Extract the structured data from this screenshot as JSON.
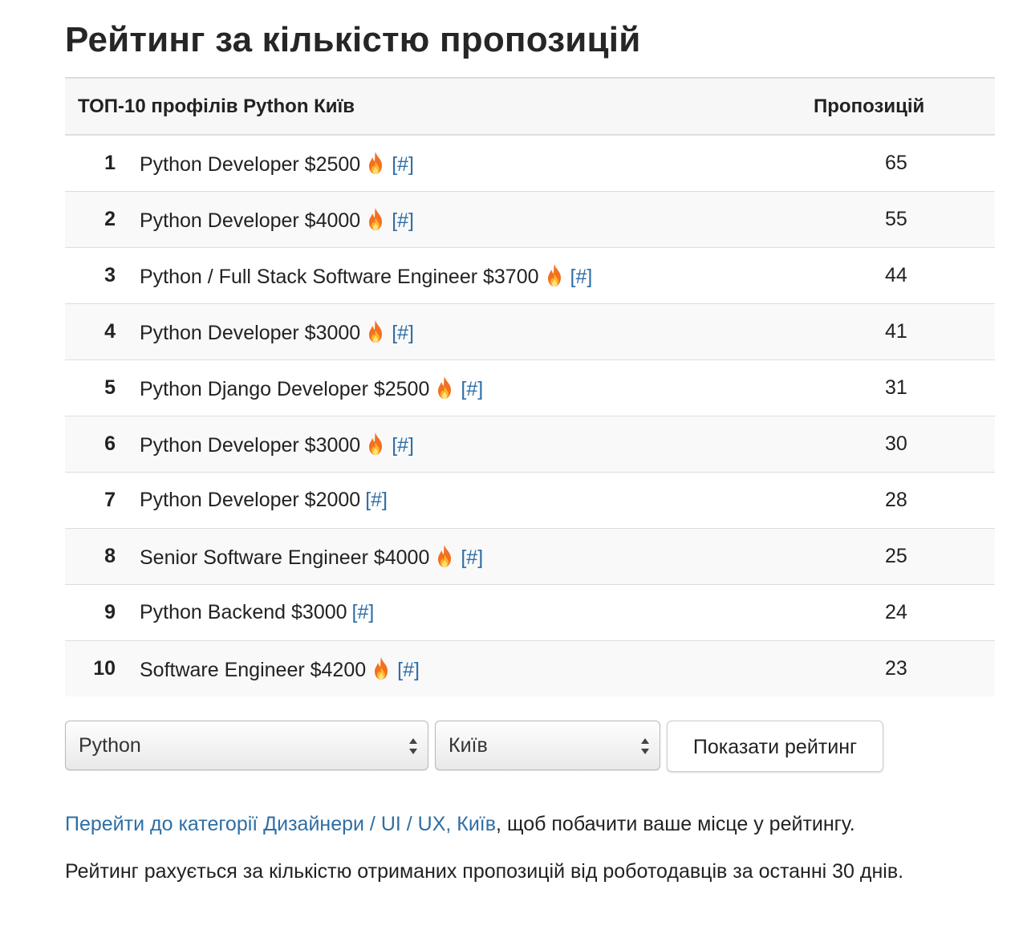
{
  "page": {
    "title": "Рейтинг за кількістю пропозицій"
  },
  "table": {
    "header_title": "ТОП-10 профілів Python Київ",
    "header_count": "Пропозицій",
    "anchor_label": "[#]",
    "rows": [
      {
        "rank": "1",
        "title": "Python Developer $2500",
        "hot": true,
        "count": "65"
      },
      {
        "rank": "2",
        "title": "Python Developer $4000",
        "hot": true,
        "count": "55"
      },
      {
        "rank": "3",
        "title": "Python / Full Stack Software Engineer $3700",
        "hot": true,
        "count": "44"
      },
      {
        "rank": "4",
        "title": "Python Developer $3000",
        "hot": true,
        "count": "41"
      },
      {
        "rank": "5",
        "title": "Python Django Developer $2500",
        "hot": true,
        "count": "31"
      },
      {
        "rank": "6",
        "title": "Python Developer $3000",
        "hot": true,
        "count": "30"
      },
      {
        "rank": "7",
        "title": "Python Developer $2000",
        "hot": false,
        "count": "28"
      },
      {
        "rank": "8",
        "title": "Senior Software Engineer $4000",
        "hot": true,
        "count": "25"
      },
      {
        "rank": "9",
        "title": "Python Backend $3000",
        "hot": false,
        "count": "24"
      },
      {
        "rank": "10",
        "title": "Software Engineer $4200",
        "hot": true,
        "count": "23"
      }
    ]
  },
  "filters": {
    "language_value": "Python",
    "city_value": "Київ",
    "show_button_label": "Показати рейтинг"
  },
  "info": {
    "category_link": "Перейти до категорії Дизайнери / UI / UX, Київ",
    "category_suffix": ", щоб побачити ваше місце у рейтингу.",
    "note": "Рейтинг рахується за кількістю отриманих пропозицій від роботодавців за останні 30 днів."
  },
  "icons": {
    "hot": "fire-icon",
    "select_arrows": "select-arrows-icon"
  },
  "colors": {
    "link": "#2f6ea5",
    "fire": "#f26b1d"
  }
}
